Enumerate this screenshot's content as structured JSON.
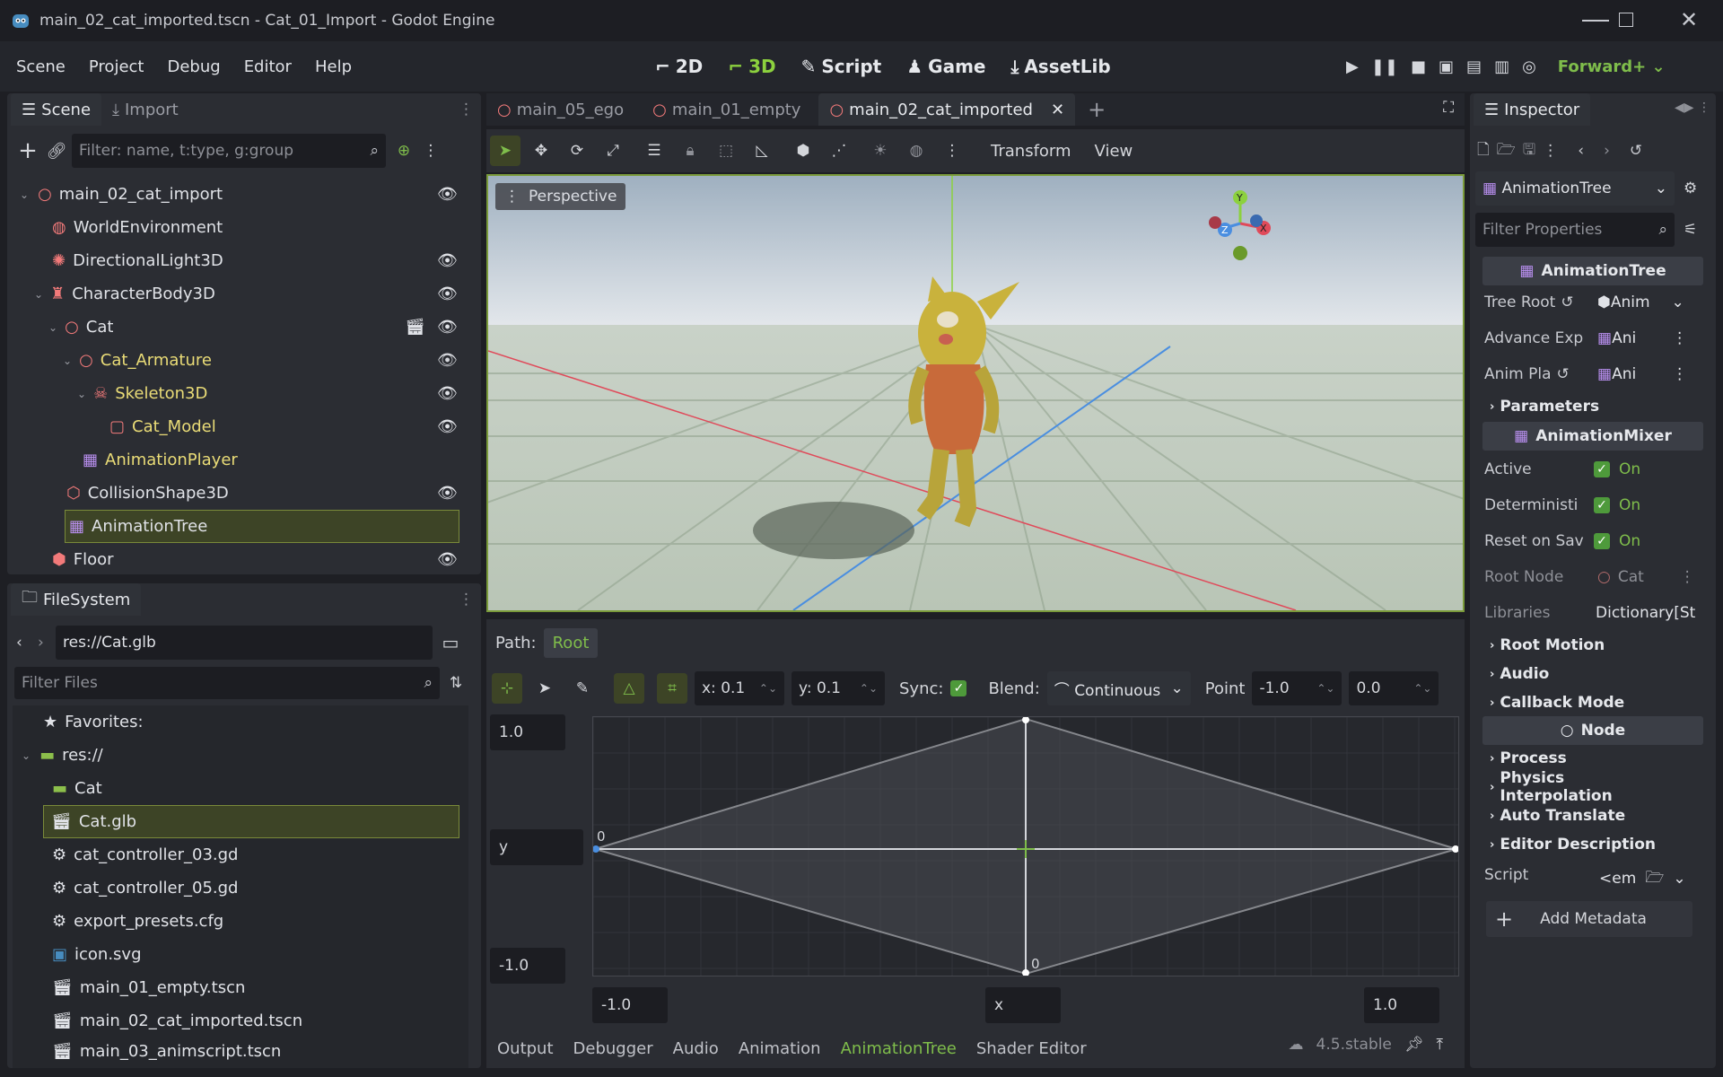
{
  "titlebar": {
    "title": "main_02_cat_imported.tscn - Cat_01_Import - Godot Engine"
  },
  "menu": [
    "Scene",
    "Project",
    "Debug",
    "Editor",
    "Help"
  ],
  "workspaces": [
    "2D",
    "3D",
    "Script",
    "Game",
    "AssetLib"
  ],
  "renderer": "Forward+",
  "scene_panel": {
    "tabs": [
      "Scene",
      "Import"
    ],
    "filter_placeholder": "Filter: name, t:type, g:group",
    "nodes": [
      "main_02_cat_import",
      "WorldEnvironment",
      "DirectionalLight3D",
      "CharacterBody3D",
      "Cat",
      "Cat_Armature",
      "Skeleton3D",
      "Cat_Model",
      "AnimationPlayer",
      "CollisionShape3D",
      "AnimationTree",
      "Floor"
    ]
  },
  "filesystem": {
    "title": "FileSystem",
    "path": "res://Cat.glb",
    "filter_placeholder": "Filter Files",
    "items": [
      "Favorites:",
      "res://",
      "Cat",
      "Cat.glb",
      "cat_controller_03.gd",
      "cat_controller_05.gd",
      "export_presets.cfg",
      "icon.svg",
      "main_01_empty.tscn",
      "main_02_cat_imported.tscn",
      "main_03_animscript.tscn"
    ]
  },
  "editor_tabs": [
    "main_05_ego",
    "main_01_empty",
    "main_02_cat_imported"
  ],
  "viewport_toolbar": {
    "transform": "Transform",
    "view": "View",
    "perspective": "Perspective"
  },
  "gizmo": {
    "x": "X",
    "y": "Y",
    "z": "Z"
  },
  "animtree": {
    "path_label": "Path:",
    "path_root": "Root",
    "snap_x": "x: 0.1",
    "snap_y": "y: 0.1",
    "sync_label": "Sync:",
    "blend_label": "Blend:",
    "blend_value": "Continuous",
    "point_label": "Point",
    "point_x": "-1.0",
    "point_y": "0.0",
    "max_y": "1.0",
    "y_label": "y",
    "min_y": "-1.0",
    "min_x": "-1.0",
    "x_label": "x",
    "max_x": "1.0",
    "zero_left": "0",
    "zero_bottom": "0"
  },
  "bottom_tabs": [
    "Output",
    "Debugger",
    "Audio",
    "Animation",
    "AnimationTree",
    "Shader Editor"
  ],
  "version": "4.5.stable",
  "inspector": {
    "title": "Inspector",
    "node_select": "AnimationTree",
    "filter_placeholder": "Filter Properties",
    "class_header": "AnimationTree",
    "tree_root_label": "Tree Root",
    "tree_root_value": "Anim",
    "advance_exp_label": "Advance Exp",
    "advance_exp_value": "Ani",
    "anim_player_label": "Anim Pla",
    "anim_player_value": "Ani",
    "parameters": "Parameters",
    "mixer_header": "AnimationMixer",
    "active_label": "Active",
    "deterministic_label": "Deterministi",
    "reset_label": "Reset on Sav",
    "on": "On",
    "root_node_label": "Root Node",
    "root_node_value": "Cat",
    "libraries_label": "Libraries",
    "libraries_value": "Dictionary[St",
    "root_motion": "Root Motion",
    "audio": "Audio",
    "callback_mode": "Callback Mode",
    "node_header": "Node",
    "process": "Process",
    "physics_interp": "Physics Interpolation",
    "auto_translate": "Auto Translate",
    "editor_description": "Editor Description",
    "script_label": "Script",
    "script_value": "<em",
    "add_metadata": "Add Metadata"
  },
  "colors": {
    "accent": "#7fbd4b",
    "yellow_text": "#eadc77",
    "axis_x": "#e04a5a",
    "axis_y": "#8cd13e",
    "axis_z": "#4a8ee0"
  }
}
